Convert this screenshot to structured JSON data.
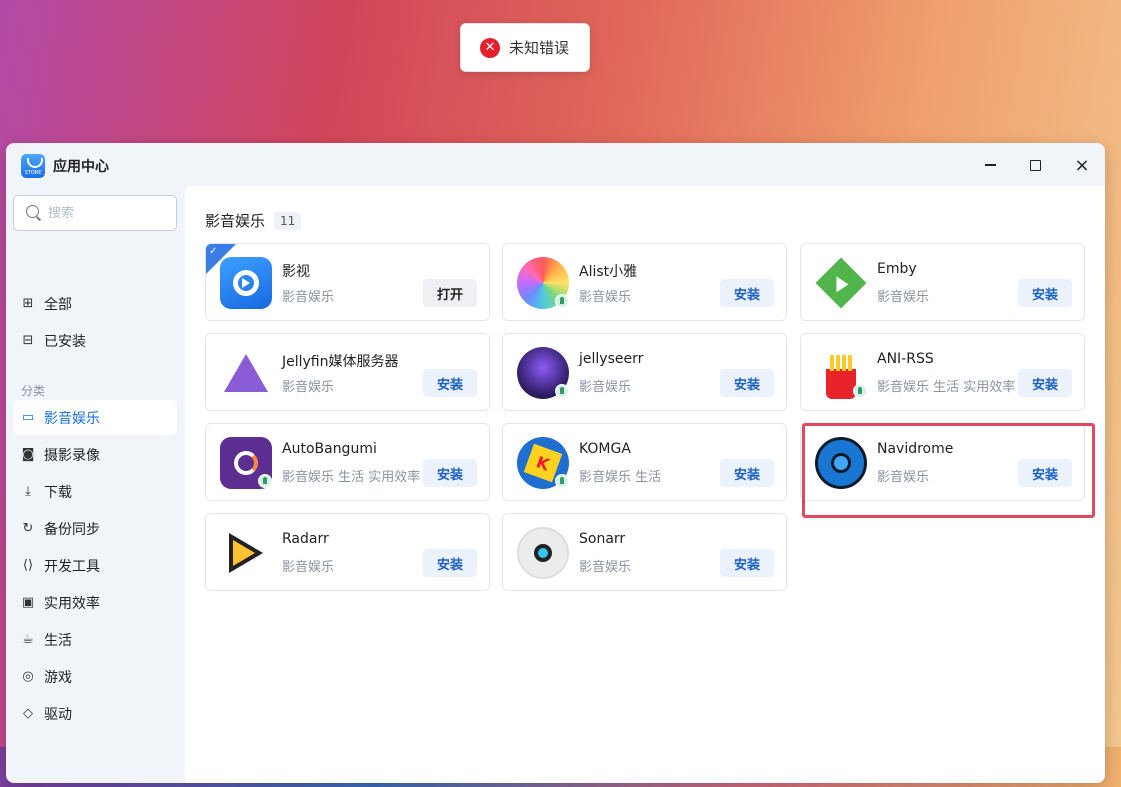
{
  "toast": {
    "icon": "error-circle-icon",
    "text": "未知错误",
    "color": "#e5202e"
  },
  "window": {
    "title": "应用中心",
    "logo_text": "STORE",
    "controls": {
      "minimize": "minimize-icon",
      "maximize": "maximize-icon",
      "close": "×"
    }
  },
  "sidebar": {
    "search_placeholder": "搜索",
    "top_items": [
      {
        "label": "全部",
        "icon": "grid-icon",
        "glyph": "⊞"
      },
      {
        "label": "已安装",
        "icon": "installed-icon",
        "glyph": "⊟"
      }
    ],
    "section_label": "分类",
    "categories": [
      {
        "label": "影音娱乐",
        "icon": "video-icon",
        "glyph": "▭",
        "active": true
      },
      {
        "label": "摄影录像",
        "icon": "camera-icon",
        "glyph": "◙"
      },
      {
        "label": "下载",
        "icon": "download-icon",
        "glyph": "⤓"
      },
      {
        "label": "备份同步",
        "icon": "sync-icon",
        "glyph": "↻"
      },
      {
        "label": "开发工具",
        "icon": "code-icon",
        "glyph": "⟨⟩"
      },
      {
        "label": "实用效率",
        "icon": "toolbox-icon",
        "glyph": "▣"
      },
      {
        "label": "生活",
        "icon": "cup-icon",
        "glyph": "☕"
      },
      {
        "label": "游戏",
        "icon": "gamepad-icon",
        "glyph": "◎"
      },
      {
        "label": "驱动",
        "icon": "cube-icon",
        "glyph": "◇"
      }
    ],
    "accent_color": "#1a73e8"
  },
  "main": {
    "category_title": "影音娱乐",
    "category_count": "11",
    "apps": [
      {
        "name": "影视",
        "tags": "影音娱乐",
        "button": "打开",
        "installed": true,
        "icon": "yingshi-icon"
      },
      {
        "name": "Alist小雅",
        "tags": "影音娱乐",
        "button": "安装",
        "icon": "alist-icon"
      },
      {
        "name": "Emby",
        "tags": "影音娱乐",
        "button": "安装",
        "icon": "emby-icon"
      },
      {
        "name": "Jellyfin媒体服务器",
        "tags": "影音娱乐",
        "button": "安装",
        "icon": "jellyfin-icon"
      },
      {
        "name": "jellyseerr",
        "tags": "影音娱乐",
        "button": "安装",
        "icon": "jellyseerr-icon"
      },
      {
        "name": "ANI-RSS",
        "tags": "影音娱乐 生活 实用效率",
        "button": "安装",
        "icon": "ani-rss-icon"
      },
      {
        "name": "AutoBangumi",
        "tags": "影音娱乐 生活 实用效率",
        "button": "安装",
        "icon": "autobangumi-icon"
      },
      {
        "name": "KOMGA",
        "tags": "影音娱乐 生活",
        "button": "安装",
        "icon": "komga-icon"
      },
      {
        "name": "Navidrome",
        "tags": "影音娱乐",
        "button": "安装",
        "icon": "navidrome-icon",
        "highlighted": true
      },
      {
        "name": "Radarr",
        "tags": "影音娱乐",
        "button": "安装",
        "icon": "radarr-icon"
      },
      {
        "name": "Sonarr",
        "tags": "影音娱乐",
        "button": "安装",
        "icon": "sonarr-icon"
      }
    ],
    "highlight_color": "#e8485e",
    "install_button_bg": "#ebf2fb",
    "install_button_text": "#1a5fc4"
  }
}
